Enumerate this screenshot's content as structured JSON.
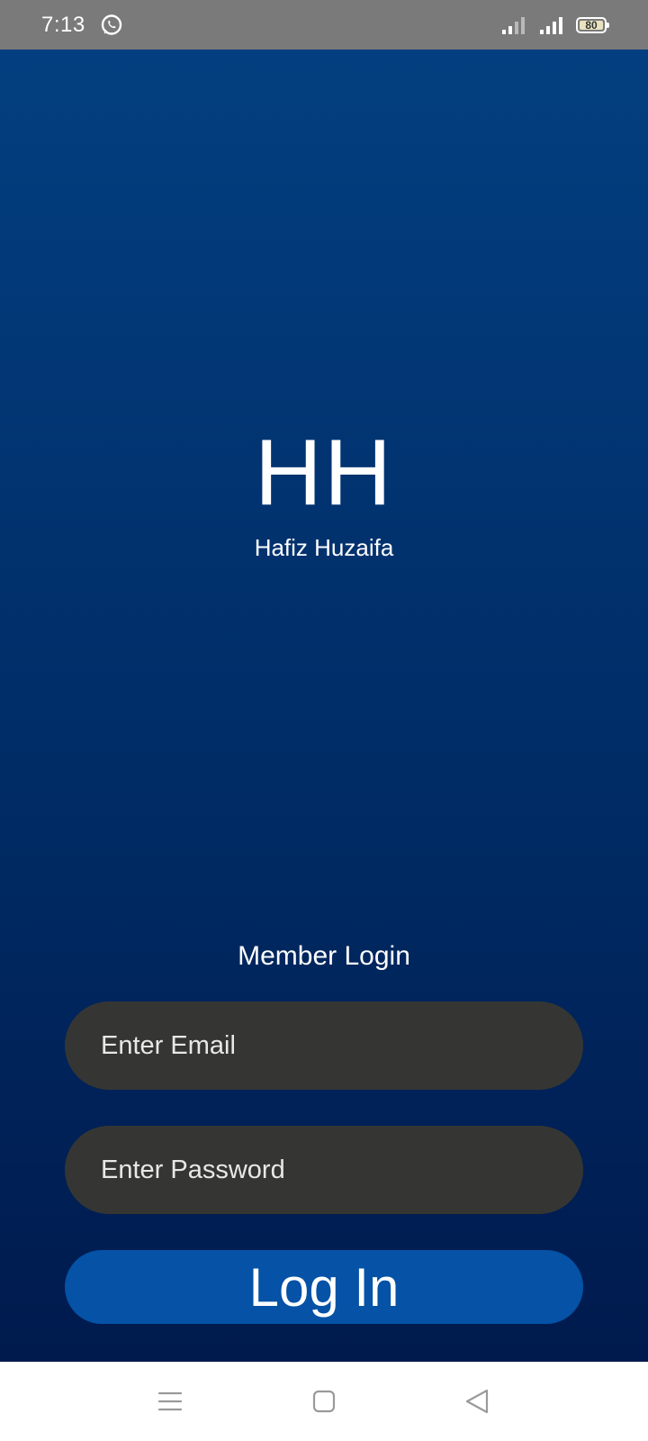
{
  "status_bar": {
    "time": "7:13",
    "battery_level": "80",
    "icons": [
      "whatsapp-icon",
      "signal-icon",
      "signal-icon",
      "battery-icon"
    ]
  },
  "app": {
    "logo_text": "HH",
    "logo_name": "Hafiz Huzaifa",
    "section_title": "Member Login",
    "email_placeholder": "Enter Email",
    "password_placeholder": "Enter Password",
    "login_label": "Log In"
  },
  "nav_bar": {
    "icons": [
      "menu-icon",
      "home-icon",
      "back-icon"
    ]
  },
  "colors": {
    "gradient_top": "#033f80",
    "gradient_bottom": "#001a4d",
    "field_bg": "#353633",
    "button_bg": "#0552a6",
    "status_bar_bg": "#7a7a7a"
  }
}
